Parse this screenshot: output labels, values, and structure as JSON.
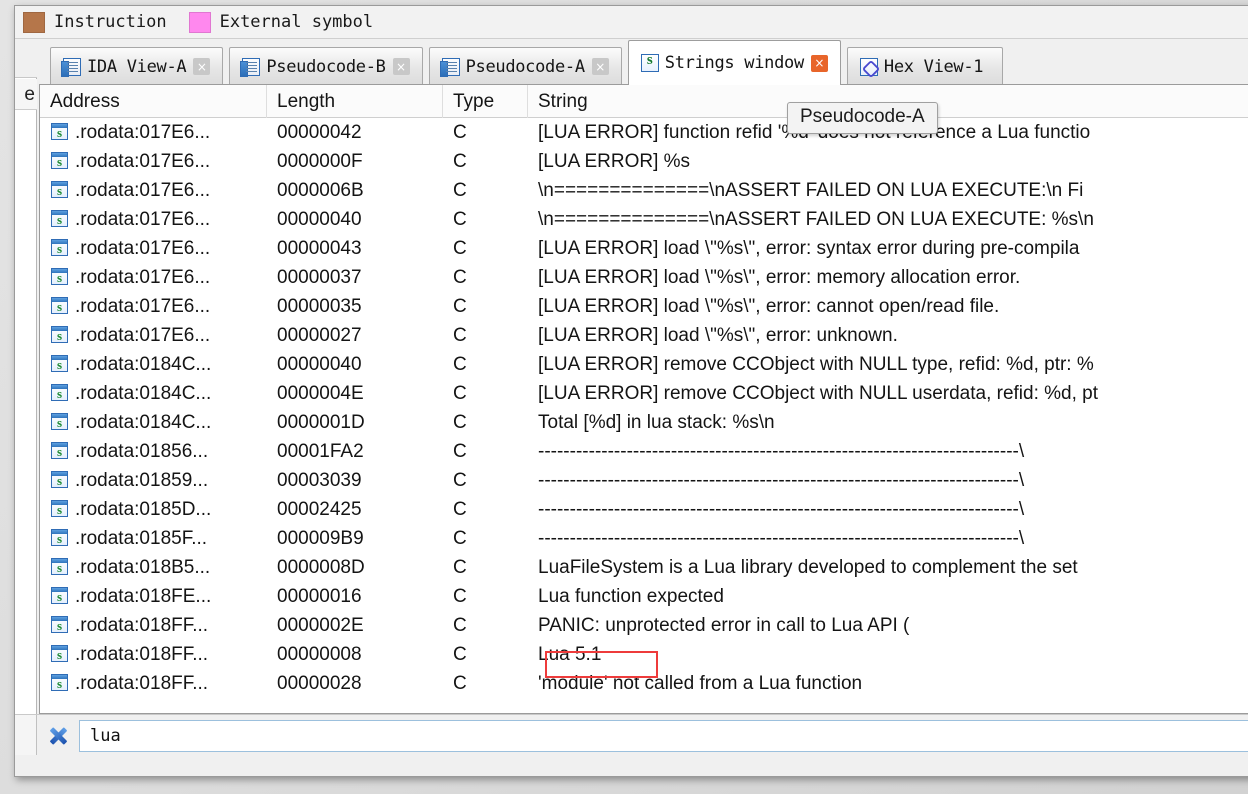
{
  "legend": {
    "items": [
      {
        "label": "Instruction",
        "color": "#b5764a",
        "icon": "color-swatch"
      },
      {
        "label": "External symbol",
        "color": "#ff88ee",
        "icon": "color-swatch"
      }
    ]
  },
  "tabs": [
    {
      "label": "IDA View-A",
      "icon": "document-icon",
      "active": false,
      "close": "×"
    },
    {
      "label": "Pseudocode-B",
      "icon": "document-icon",
      "active": false,
      "close": "×"
    },
    {
      "label": "Pseudocode-A",
      "icon": "document-icon",
      "active": false,
      "close": "×"
    },
    {
      "label": "Strings window",
      "icon": "strings-icon",
      "active": true,
      "close": "×"
    },
    {
      "label": "Hex View-1",
      "icon": "hex-icon",
      "active": false,
      "close": ""
    }
  ],
  "tooltip": {
    "text": "Pseudocode-A"
  },
  "left_sliver": {
    "header_fragment": "e"
  },
  "table": {
    "columns": [
      "Address",
      "Length",
      "Type",
      "String"
    ],
    "rows": [
      {
        "icon": "string-item-icon",
        "address": ".rodata:017E6...",
        "length": "00000042",
        "type": "C",
        "string": "[LUA ERROR] function refid '%d' does not reference a Lua functio"
      },
      {
        "icon": "string-item-icon",
        "address": ".rodata:017E6...",
        "length": "0000000F",
        "type": "C",
        "string": "[LUA ERROR] %s"
      },
      {
        "icon": "string-item-icon",
        "address": ".rodata:017E6...",
        "length": "0000006B",
        "type": "C",
        "string": "\\n==============\\nASSERT FAILED ON LUA EXECUTE:\\n   Fi"
      },
      {
        "icon": "string-item-icon",
        "address": ".rodata:017E6...",
        "length": "00000040",
        "type": "C",
        "string": "\\n==============\\nASSERT FAILED ON LUA EXECUTE: %s\\n"
      },
      {
        "icon": "string-item-icon",
        "address": ".rodata:017E6...",
        "length": "00000043",
        "type": "C",
        "string": "[LUA ERROR] load \\\"%s\\\", error: syntax error during pre-compila"
      },
      {
        "icon": "string-item-icon",
        "address": ".rodata:017E6...",
        "length": "00000037",
        "type": "C",
        "string": "[LUA ERROR] load \\\"%s\\\", error: memory allocation error."
      },
      {
        "icon": "string-item-icon",
        "address": ".rodata:017E6...",
        "length": "00000035",
        "type": "C",
        "string": "[LUA ERROR] load \\\"%s\\\", error: cannot open/read file."
      },
      {
        "icon": "string-item-icon",
        "address": ".rodata:017E6...",
        "length": "00000027",
        "type": "C",
        "string": "[LUA ERROR] load \\\"%s\\\", error: unknown."
      },
      {
        "icon": "string-item-icon",
        "address": ".rodata:0184C...",
        "length": "00000040",
        "type": "C",
        "string": "[LUA ERROR] remove CCObject with NULL type, refid: %d, ptr: %"
      },
      {
        "icon": "string-item-icon",
        "address": ".rodata:0184C...",
        "length": "0000004E",
        "type": "C",
        "string": "[LUA ERROR] remove CCObject with NULL userdata, refid: %d, pt"
      },
      {
        "icon": "string-item-icon",
        "address": ".rodata:0184C...",
        "length": "0000001D",
        "type": "C",
        "string": "Total [%d] in lua stack: %s\\n"
      },
      {
        "icon": "string-item-icon",
        "address": ".rodata:01856...",
        "length": "00001FA2",
        "type": "C",
        "string": "----------------------------------------------------------------------------\\"
      },
      {
        "icon": "string-item-icon",
        "address": ".rodata:01859...",
        "length": "00003039",
        "type": "C",
        "string": "----------------------------------------------------------------------------\\"
      },
      {
        "icon": "string-item-icon",
        "address": ".rodata:0185D...",
        "length": "00002425",
        "type": "C",
        "string": "----------------------------------------------------------------------------\\"
      },
      {
        "icon": "string-item-icon",
        "address": ".rodata:0185F...",
        "length": "000009B9",
        "type": "C",
        "string": "----------------------------------------------------------------------------\\"
      },
      {
        "icon": "string-item-icon",
        "address": ".rodata:018B5...",
        "length": "0000008D",
        "type": "C",
        "string": "LuaFileSystem is a Lua library developed to complement the set"
      },
      {
        "icon": "string-item-icon",
        "address": ".rodata:018FE...",
        "length": "00000016",
        "type": "C",
        "string": "Lua function expected"
      },
      {
        "icon": "string-item-icon",
        "address": ".rodata:018FF...",
        "length": "0000002E",
        "type": "C",
        "string": "PANIC: unprotected error in call to Lua API ("
      },
      {
        "icon": "string-item-icon",
        "address": ".rodata:018FF...",
        "length": "00000008",
        "type": "C",
        "string": "Lua 5.1",
        "annotated": true
      },
      {
        "icon": "string-item-icon",
        "address": ".rodata:018FF...",
        "length": "00000028",
        "type": "C",
        "string": "'module' not called from a Lua function"
      }
    ]
  },
  "search": {
    "value": "lua",
    "placeholder": "",
    "clear_icon": "clear-filter-icon"
  },
  "colors": {
    "annotation": "#ee3b3b",
    "active_tab_close": "#e8652a",
    "instruction_swatch": "#b5764a",
    "external_symbol_swatch": "#ff88ee"
  }
}
